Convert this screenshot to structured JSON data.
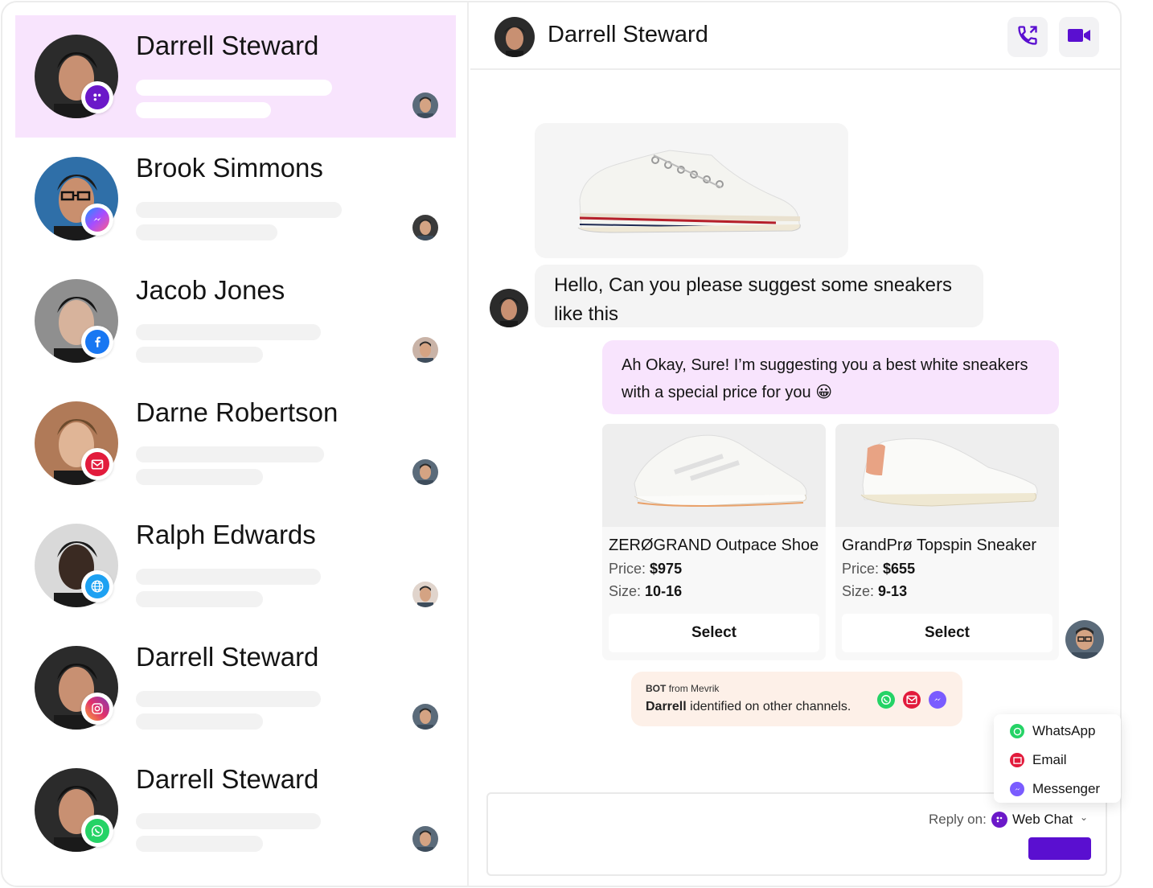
{
  "colors": {
    "accent": "#5a0fd0",
    "active_row": "#f8e4fd",
    "outgoing_bubble": "#f8e4fd",
    "bot_note": "#fdf0e8",
    "whatsapp": "#25d366",
    "email": "#e21b3c",
    "messenger": "#7a5cff",
    "facebook": "#1877f2",
    "web": "#1da1f2"
  },
  "contacts": [
    {
      "name": "Darrell Steward",
      "channel": "webchat-icon",
      "active": true
    },
    {
      "name": "Brook Simmons",
      "channel": "messenger-icon",
      "active": false
    },
    {
      "name": "Jacob Jones",
      "channel": "facebook-icon",
      "active": false
    },
    {
      "name": "Darne Robertson",
      "channel": "email-icon",
      "active": false
    },
    {
      "name": "Ralph Edwards",
      "channel": "globe-icon",
      "active": false
    },
    {
      "name": "Darrell Steward",
      "channel": "instagram-icon",
      "active": false
    },
    {
      "name": "Darrell Steward",
      "channel": "whatsapp-icon",
      "active": false
    }
  ],
  "header": {
    "name": "Darrell Steward",
    "call_icon": "phone-icon",
    "video_icon": "video-camera-icon"
  },
  "messages": {
    "incoming": "Hello, Can  you please suggest some sneakers like this",
    "outgoing": "Ah Okay, Sure! I’m suggesting you a best white sneakers with a special price for you 😀"
  },
  "products": [
    {
      "title": "ZERØGRAND Outpace Shoe",
      "price_label": "Price:",
      "price": "$975",
      "size_label": "Size:",
      "size": "10-16",
      "button": "Select"
    },
    {
      "title": "GrandPrø Topspin Sneaker",
      "price_label": "Price:",
      "price": "$655",
      "size_label": "Size:",
      "size": "9-13",
      "button": "Select"
    }
  ],
  "bot_note": {
    "tag": "BOT",
    "from": "from Mevrik",
    "name": "Darrell",
    "text": "identified on other channels."
  },
  "dropdown": {
    "items": [
      "WhatsApp",
      "Email",
      "Messenger"
    ]
  },
  "composer": {
    "reply_label": "Reply on:",
    "channel": "Web Chat"
  }
}
